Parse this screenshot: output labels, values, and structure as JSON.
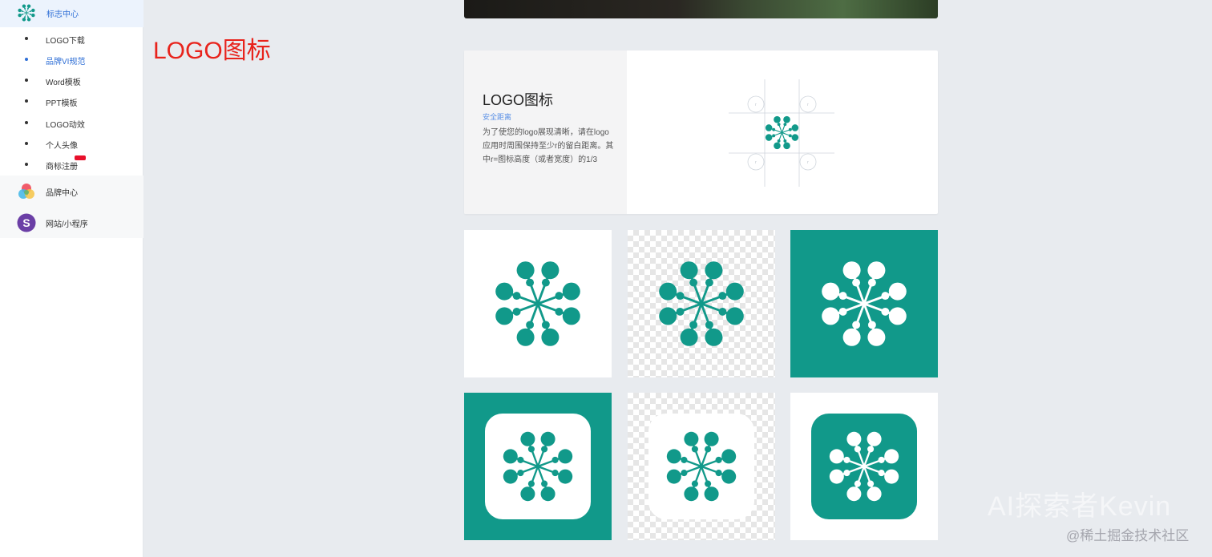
{
  "colors": {
    "brand_teal": "#11998a",
    "accent_blue": "#2f6fd6",
    "heading_red": "#e8231c",
    "badge_red": "#e8102b"
  },
  "sidebar": {
    "header": {
      "icon": "snowflake-logo-icon",
      "label": "标志中心"
    },
    "sub_items": [
      {
        "label": "LOGO下载",
        "active": false
      },
      {
        "label": "品牌VI规范",
        "active": true
      },
      {
        "label": "Word模板",
        "active": false
      },
      {
        "label": "PPT模板",
        "active": false
      },
      {
        "label": "LOGO动效",
        "active": false
      },
      {
        "label": "个人头像",
        "active": false
      },
      {
        "label": "商标注册",
        "active": false,
        "badge": true
      }
    ],
    "main_items": [
      {
        "icon": "brand-circles-icon",
        "label": "品牌中心"
      },
      {
        "icon": "s-letter-icon",
        "label": "网站/小程序",
        "icon_text": "S"
      }
    ]
  },
  "annotation": {
    "heading": "LOGO图标"
  },
  "info_card": {
    "title": "LOGO图标",
    "subtitle": "安全距离",
    "description": "为了使您的logo展现清晰，请在logo应用时周围保持至少r的留白距离。其中r=图标高度（或者宽度）的1/3",
    "r_label": "r"
  },
  "tiles": [
    {
      "name": "tile-teal-on-white",
      "bg": "white",
      "style": "plain",
      "logo_color": "#11998a"
    },
    {
      "name": "tile-teal-on-transparent",
      "bg": "checker",
      "style": "plain",
      "logo_color": "#11998a"
    },
    {
      "name": "tile-white-on-teal",
      "bg": "teal",
      "style": "plain",
      "logo_color": "#ffffff"
    },
    {
      "name": "tile-app-icon-white-on-teal",
      "bg": "teal",
      "style": "rounded-white",
      "logo_color": "#11998a"
    },
    {
      "name": "tile-app-icon-white-on-transparent",
      "bg": "checker",
      "style": "rounded-white",
      "logo_color": "#11998a"
    },
    {
      "name": "tile-app-icon-teal-on-white",
      "bg": "white",
      "style": "rounded-teal",
      "logo_color": "#ffffff"
    }
  ],
  "watermarks": {
    "author": "AI探索者Kevin",
    "site": "@稀土掘金技术社区"
  }
}
